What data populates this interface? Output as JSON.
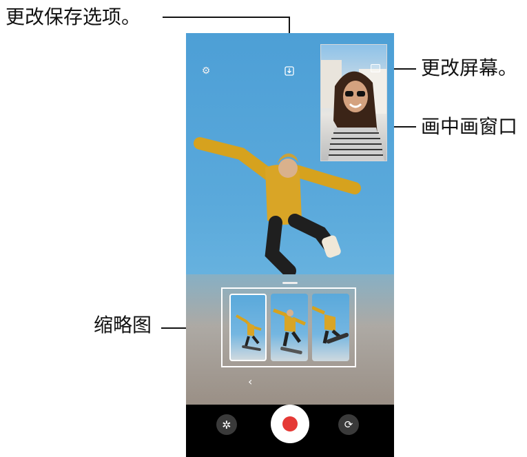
{
  "callouts": {
    "save_options": "更改保存选项。",
    "switch_screen": "更改屏幕。",
    "pip_window": "画中画窗口",
    "thumbnails": "缩略图"
  },
  "icons": {
    "settings": "gear-icon",
    "save_option": "download-icon",
    "switch_screen": "screen-switch-icon",
    "back_chevron": "chevron-left-icon",
    "effects": "effects-icon",
    "record": "record-icon",
    "switch_camera": "switch-camera-icon"
  },
  "colors": {
    "record": "#e53935",
    "sky": "#5aa9db",
    "bottom_bar": "#000000"
  },
  "thumbnails": [
    {
      "name": "thumbnail-1",
      "selected": true
    },
    {
      "name": "thumbnail-2",
      "selected": false
    },
    {
      "name": "thumbnail-3",
      "selected": false
    }
  ]
}
